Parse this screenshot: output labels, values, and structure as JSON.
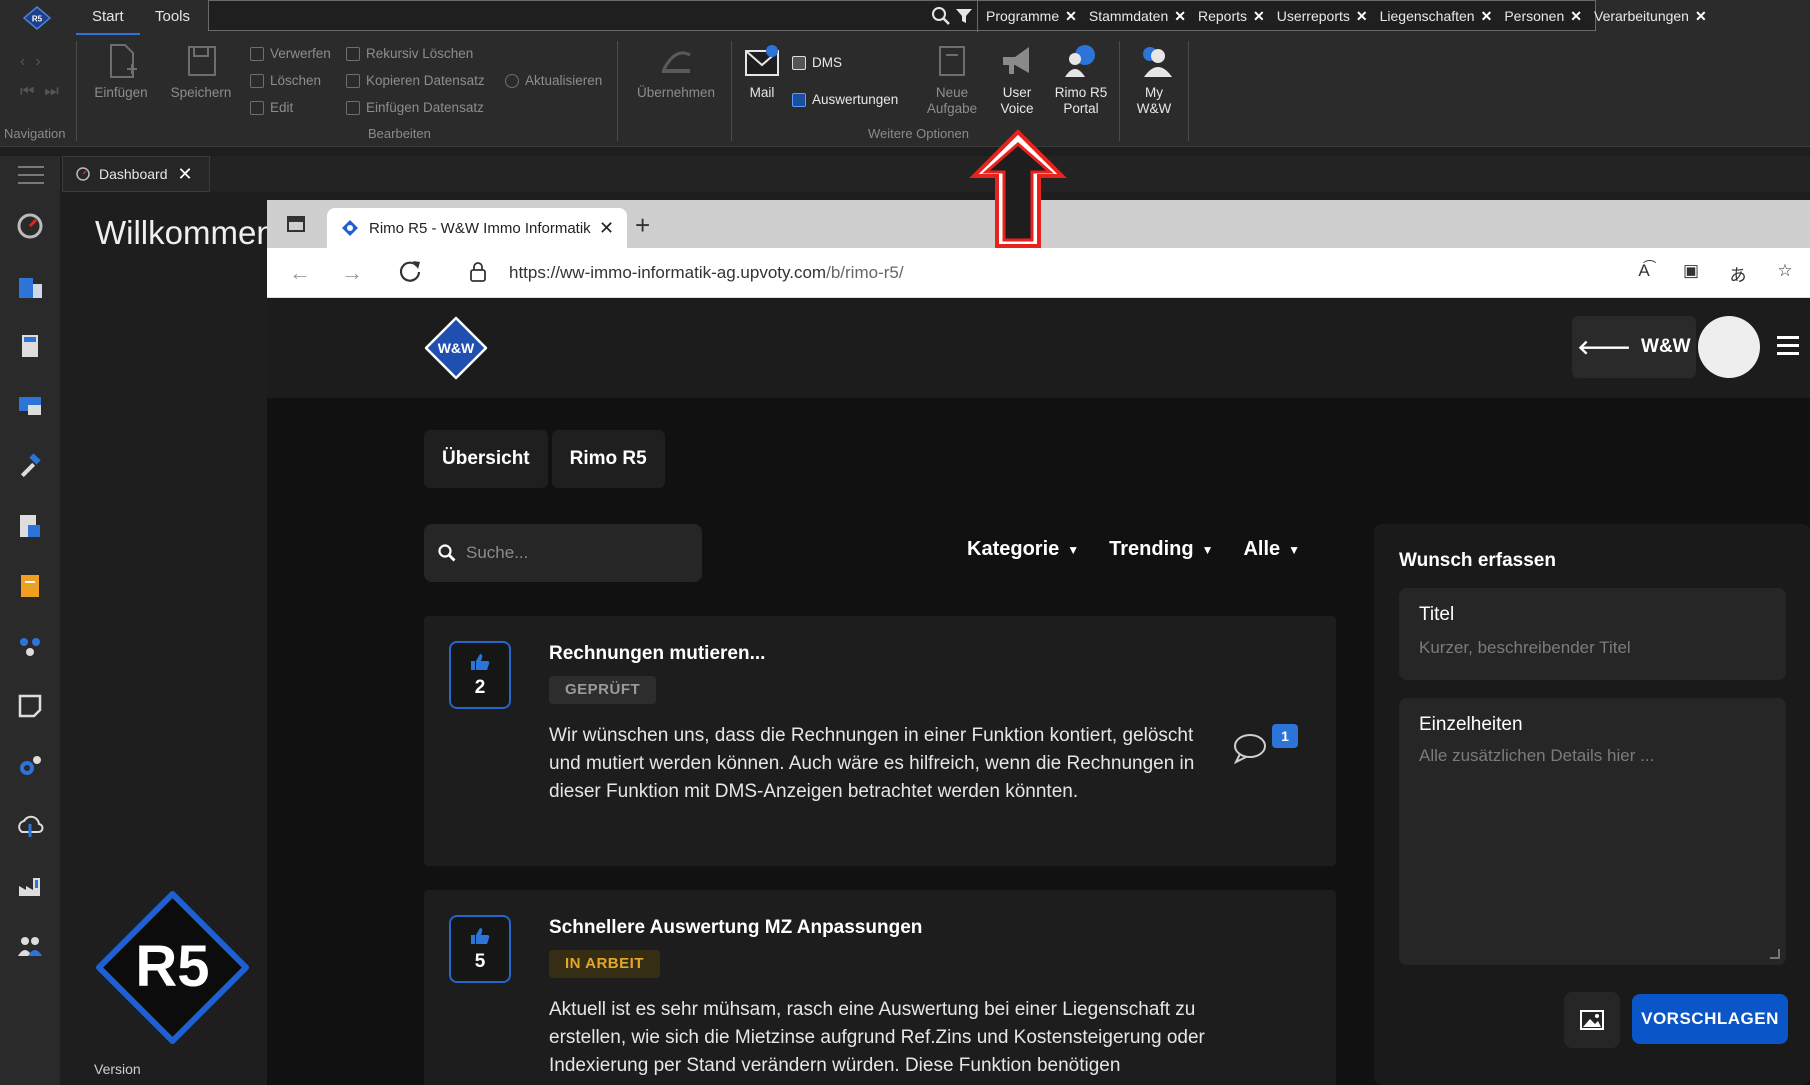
{
  "app": {
    "logo_text": "R5",
    "tabs": [
      {
        "label": "Start"
      },
      {
        "label": "Tools"
      }
    ],
    "quick_chips": [
      "Programme",
      "Stammdaten",
      "Reports",
      "Userreports",
      "Liegenschaften",
      "Personen",
      "Verarbeitungen"
    ]
  },
  "ribbon": {
    "navigation_label": "Navigation",
    "bearbeiten": {
      "label": "Bearbeiten",
      "einfuegen": "Einfügen",
      "speichern": "Speichern",
      "verwerfen": "Verwerfen",
      "loeschen": "Löschen",
      "edit": "Edit",
      "rekursiv_loeschen": "Rekursiv Löschen",
      "kopieren_datensatz": "Kopieren Datensatz",
      "einfuegen_datensatz": "Einfügen Datensatz",
      "aktualisieren": "Aktualisieren",
      "uebernehmen": "Übernehmen"
    },
    "weitere": {
      "label": "Weitere Optionen",
      "mail": "Mail",
      "dms": "DMS",
      "auswertungen": "Auswertungen",
      "neue_aufgabe_1": "Neue",
      "neue_aufgabe_2": "Aufgabe",
      "user_voice_1": "User",
      "user_voice_2": "Voice",
      "rimo_portal_1": "Rimo R5",
      "rimo_portal_2": "Portal"
    },
    "my_ww_1": "My",
    "my_ww_2": "W&W"
  },
  "dashboard": {
    "tab_label": "Dashboard",
    "welcome": "Willkommen",
    "logo_text": "R5",
    "version_label": "Version"
  },
  "browser": {
    "tab_title": "Rimo R5 - W&W Immo Informatik",
    "url_domain": "https://ww-immo-informatik-ag.upvoty.com",
    "url_path": "/b/rimo-r5/"
  },
  "site": {
    "logo_text": "W&W",
    "back_label": "W&W",
    "nav_tabs": [
      "Übersicht",
      "Rimo R5"
    ],
    "search_placeholder": "Suche...",
    "filters": [
      "Kategorie",
      "Trending",
      "Alle"
    ],
    "posts": [
      {
        "votes": "2",
        "title": "Rechnungen mutieren...",
        "status": "GEPRÜFT",
        "text": "Wir wünschen uns, dass die Rechnungen in einer Funktion kontiert, gelöscht und mutiert werden können. Auch wäre es hilfreich, wenn die Rechnungen in dieser Funktion mit DMS-Anzeigen betrachtet werden könnten.",
        "comments": "1"
      },
      {
        "votes": "5",
        "title": "Schnellere Auswertung MZ Anpassungen",
        "status": "IN ARBEIT",
        "text": "Aktuell ist es sehr mühsam, rasch eine Auswertung bei einer Liegenschaft zu erstellen, wie sich die Mietzinse aufgrund Ref.Zins und Kostensteigerung oder Indexierung per Stand verändern würden. Diese Funktion benötigen"
      }
    ],
    "wish": {
      "heading": "Wunsch erfassen",
      "title_label": "Titel",
      "title_placeholder": "Kurzer, beschreibender Titel",
      "details_label": "Einzelheiten",
      "details_placeholder": "Alle zusätzlichen Details hier ...",
      "submit_label": "VORSCHLAGEN"
    }
  },
  "colors": {
    "accent_blue": "#2d74d9",
    "submit_blue": "#0a55c7",
    "status_yellow": "#e3a72a",
    "annotation_red": "#e8231e"
  }
}
